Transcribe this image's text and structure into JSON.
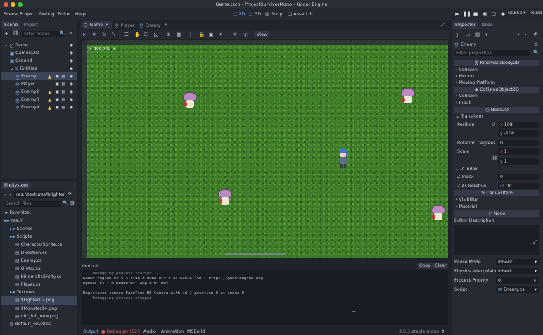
{
  "window": {
    "title": "Game.tscn - ProjectSurvivorMono - Godot Engine"
  },
  "menu": [
    "Scene",
    "Project",
    "Debug",
    "Editor",
    "Help"
  ],
  "workspaces": [
    {
      "label": "2D",
      "icon": "2d-icon",
      "active": true
    },
    {
      "label": "3D",
      "icon": "3d-icon",
      "active": false
    },
    {
      "label": "Script",
      "icon": "script-icon",
      "active": false
    },
    {
      "label": "AssetLib",
      "icon": "assetlib-icon",
      "active": false
    }
  ],
  "renderer": "GLES2",
  "build_label": "Build",
  "scene_dock": {
    "tabs": [
      "Scene",
      "Import"
    ],
    "filter_placeholder": "Filter nodes",
    "tree": [
      {
        "label": "Game",
        "depth": 0,
        "icon": "node2d-icon"
      },
      {
        "label": "Camera2D",
        "depth": 1,
        "icon": "camera2d-icon"
      },
      {
        "label": "Ground",
        "depth": 1,
        "icon": "tilemap-icon"
      },
      {
        "label": "Entities",
        "depth": 1,
        "icon": "ysort-icon"
      },
      {
        "label": "Enemy",
        "depth": 2,
        "icon": "kinematic-body-icon",
        "selected": true,
        "warning": true
      },
      {
        "label": "Player",
        "depth": 2,
        "icon": "kinematic-body-icon",
        "warning": false
      },
      {
        "label": "Enemy2",
        "depth": 2,
        "icon": "kinematic-body-icon",
        "warning": true
      },
      {
        "label": "Enemy3",
        "depth": 2,
        "icon": "kinematic-body-icon",
        "warning": true
      },
      {
        "label": "Enemy4",
        "depth": 2,
        "icon": "kinematic-body-icon",
        "warning": true
      }
    ]
  },
  "filesystem_dock": {
    "tab": "FileSystem",
    "path": "res://textures/brighter",
    "search_placeholder": "Search files",
    "items": [
      {
        "label": "Favorites:",
        "depth": 0,
        "kind": "favorites"
      },
      {
        "label": "res://",
        "depth": 0,
        "kind": "folder"
      },
      {
        "label": "Scenes",
        "depth": 1,
        "kind": "folder"
      },
      {
        "label": "Scripts",
        "depth": 1,
        "kind": "folder"
      },
      {
        "label": "CharacterSprite.cs",
        "depth": 2,
        "kind": "file"
      },
      {
        "label": "Direction.cs",
        "depth": 2,
        "kind": "file"
      },
      {
        "label": "Enemy.cs",
        "depth": 2,
        "kind": "file"
      },
      {
        "label": "Group.cs",
        "depth": 2,
        "kind": "file"
      },
      {
        "label": "KinematicEntity.cs",
        "depth": 2,
        "kind": "file"
      },
      {
        "label": "Player.cs",
        "depth": 2,
        "kind": "file"
      },
      {
        "label": "Textures",
        "depth": 1,
        "kind": "folder"
      },
      {
        "label": "$Fighter02.png",
        "depth": 2,
        "kind": "file",
        "selected": true
      },
      {
        "label": "$Monster14.png",
        "depth": 2,
        "kind": "file"
      },
      {
        "label": "dirt_full_new.png",
        "depth": 2,
        "kind": "file"
      },
      {
        "label": "default_env.tres",
        "depth": 1,
        "kind": "file"
      }
    ]
  },
  "editor_tabs": [
    {
      "label": "Game",
      "active": true
    },
    {
      "label": "Player",
      "active": false
    },
    {
      "label": "Enemy",
      "active": false
    }
  ],
  "viewport": {
    "view_label": "View",
    "zoom_label": "100.0 %"
  },
  "inspector": {
    "tabs": [
      "Inspector",
      "Node"
    ],
    "node_name": "Enemy",
    "filter_placeholder": "Filter properties",
    "class_headers": [
      "KinematicBody2D",
      "CollisionObject2D",
      "Node2D",
      "CanvasItem",
      "Node"
    ],
    "kinematic_props": [
      "Collision",
      "Motion",
      "Moving Platform"
    ],
    "collision_props": [
      "Collision",
      "Input"
    ],
    "transform_label": "Transform",
    "position_label": "Position",
    "position_x": "108",
    "position_y": "-108",
    "rotation_label": "Rotation Degrees",
    "rotation_value": "0",
    "scale_label": "Scale",
    "scale_x": "1",
    "scale_y": "1",
    "zindex_group": "Z Index",
    "zindex_label": "Z Index",
    "zindex_value": "0",
    "zrelative_label": "Z As Relative",
    "zrelative_value": "On",
    "canvas_props": [
      "Visibility",
      "Material"
    ],
    "editor_description": "Editor Description",
    "pause_mode_label": "Pause Mode",
    "pause_mode_value": "Inherit",
    "physics_interp_label": "Physics Interpolatio",
    "physics_interp_value": "Inherit",
    "priority_label": "Process Priority",
    "priority_value": "0",
    "script_label": "Script",
    "script_value": "Enemy.cs"
  },
  "output": {
    "title": "Output:",
    "copy_label": "Copy",
    "clear_label": "Clear",
    "lines": [
      "--- Debugging process started ---",
      "Godot Engine v3.5.3.stable.mono.official.6c814135b - https://godotengine.org",
      "OpenGL ES 2.0 Renderer: Apple M1 Max",
      "",
      "Registered camera FaceTime HD Camera with id 1 position 0 at index 0",
      "--- Debugging process stopped ---"
    ]
  },
  "bottom_tabs": [
    "Output",
    "Debugger (625)",
    "Audio",
    "Animation",
    "MSBuild"
  ],
  "version": "3.5.3.stable.mono",
  "colors": {
    "accent": "#8fb6ff",
    "warning": "#f2c744",
    "error": "#e55c5c",
    "grass": "#3c7b28"
  }
}
